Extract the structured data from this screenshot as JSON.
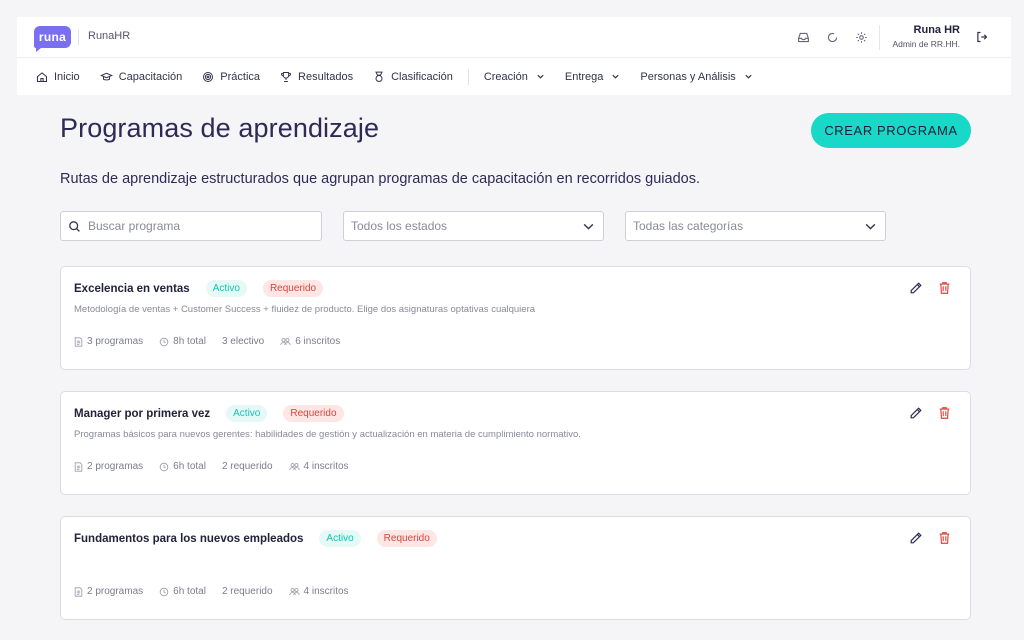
{
  "brand": {
    "logo_text": "runa",
    "name": "RunaHR"
  },
  "user": {
    "name": "Runa HR",
    "role": "Admin de RR.HH."
  },
  "top_icons": [
    "inbox-icon",
    "loading-icon",
    "gear-icon"
  ],
  "nav": {
    "items": [
      {
        "label": "Inicio",
        "icon": "home-icon"
      },
      {
        "label": "Capacitación",
        "icon": "graduation-cap-icon"
      },
      {
        "label": "Práctica",
        "icon": "target-icon"
      },
      {
        "label": "Resultados",
        "icon": "trophy-icon"
      },
      {
        "label": "Clasificación",
        "icon": "medal-icon"
      }
    ],
    "dropdowns": [
      {
        "label": "Creación"
      },
      {
        "label": "Entrega"
      },
      {
        "label": "Personas y Análisis"
      }
    ]
  },
  "page": {
    "title": "Programas de aprendizaje",
    "subtitle": "Rutas de aprendizaje estructurados que agrupan programas de capacitación en recorridos guiados.",
    "create_label": "CREAR  PROGRAMA"
  },
  "filters": {
    "search_placeholder": "Buscar programa",
    "status_value": "Todos los estados",
    "category_value": "Todas las categorías"
  },
  "colors": {
    "accent": "#18d8c8",
    "brand": "#7a6ff0",
    "danger": "#d9453c",
    "edit": "#2d2b55"
  },
  "programs": [
    {
      "title": "Excelencia en ventas",
      "status": "Activo",
      "requirement": "Requerido",
      "description": "Metodología de ventas + Customer Success + fluidez de producto. Elige dos asignaturas optativas cualquiera",
      "programs": "3 programas",
      "hours": "8h total",
      "courses": "3 electivo",
      "enrolled": "6 inscritos"
    },
    {
      "title": "Manager por primera vez",
      "status": "Activo",
      "requirement": "Requerido",
      "description": "Programas básicos para nuevos gerentes: habilidades de gestión y actualización en materia de cumplimiento normativo.",
      "programs": "2 programas",
      "hours": "6h total",
      "courses": "2 requerido",
      "enrolled": "4 inscritos"
    },
    {
      "title": "Fundamentos para los nuevos empleados",
      "status": "Activo",
      "requirement": "Requerido",
      "description": "",
      "programs": "2 programas",
      "hours": "6h total",
      "courses": "2 requerido",
      "enrolled": "4 inscritos"
    }
  ]
}
